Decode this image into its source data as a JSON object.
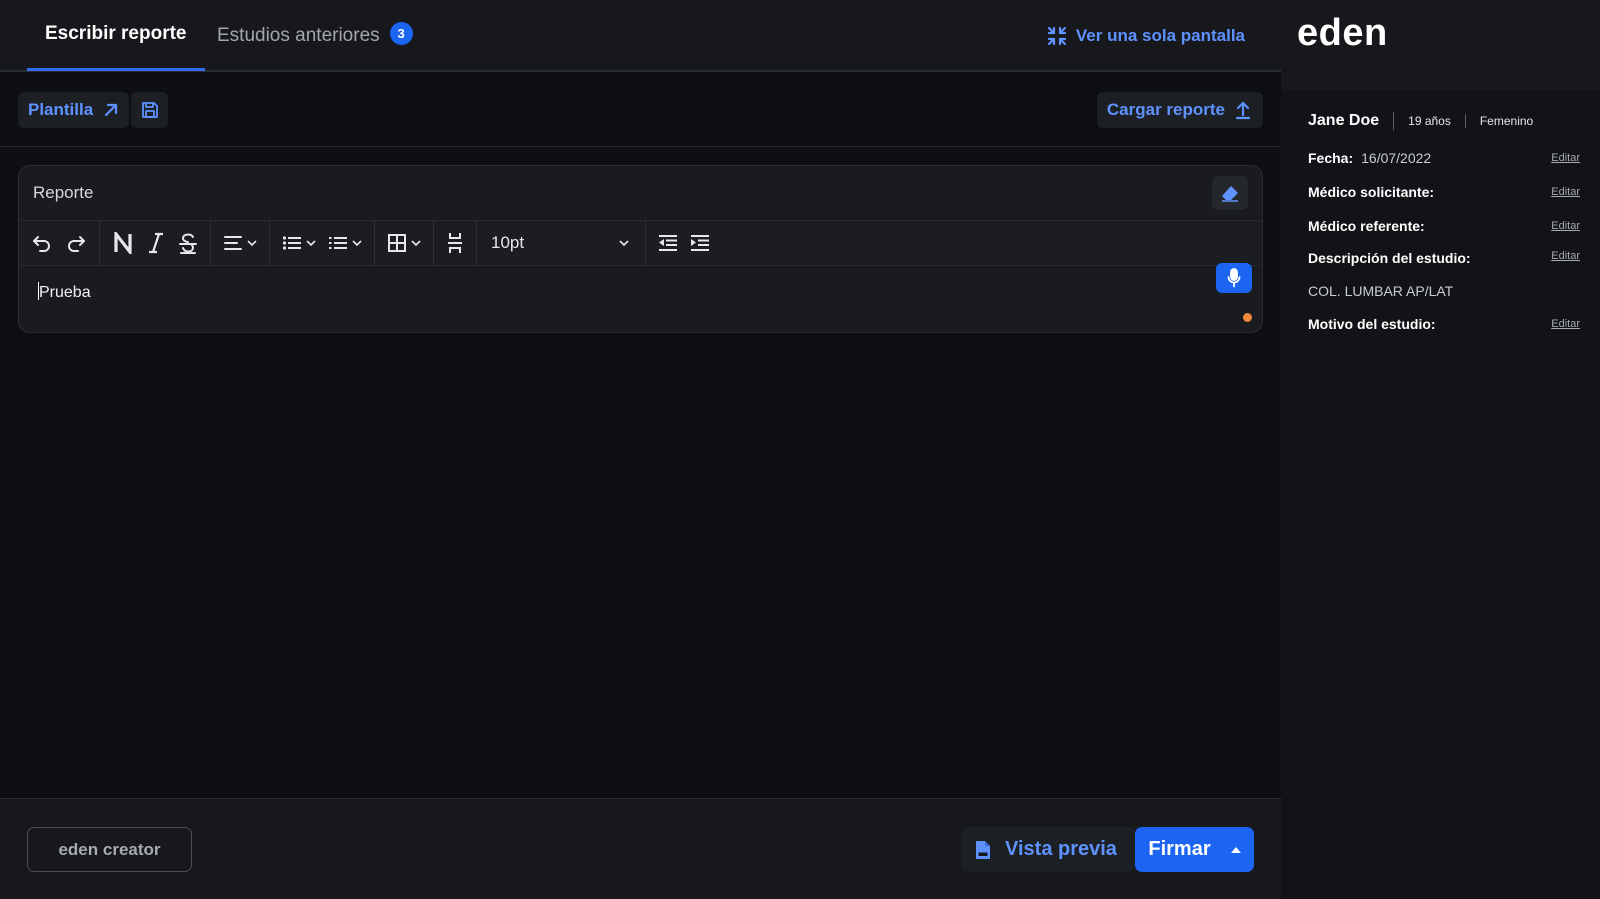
{
  "tabs": {
    "write_report": "Escribir reporte",
    "previous_studies": "Estudios anteriores",
    "previous_count": "3",
    "single_screen": "Ver una sola pantalla"
  },
  "toolbar": {
    "template": "Plantilla",
    "upload": "Cargar reporte"
  },
  "editor": {
    "title": "Reporte",
    "font_size": "10pt",
    "content": "Prueba"
  },
  "footer": {
    "creator": "eden creator",
    "preview": "Vista previa",
    "sign": "Firmar"
  },
  "sidebar": {
    "brand": "eden",
    "patient": {
      "name": "Jane Doe",
      "age": "19 años",
      "sex": "Femenino"
    },
    "edit_label": "Editar",
    "fields": {
      "date_label": "Fecha:",
      "date_value": "16/07/2022",
      "requesting_doctor": "Médico solicitante:",
      "referring_doctor": "Médico referente:",
      "study_description": "Descripción del estudio:",
      "study_description_value": "COL. LUMBAR AP/LAT",
      "study_reason": "Motivo del estudio:"
    }
  },
  "colors": {
    "accent": "#1c64f2",
    "link": "#5e92ff",
    "background": "#0e0f12",
    "panel": "#16181c",
    "status_dot": "#f0883e"
  }
}
